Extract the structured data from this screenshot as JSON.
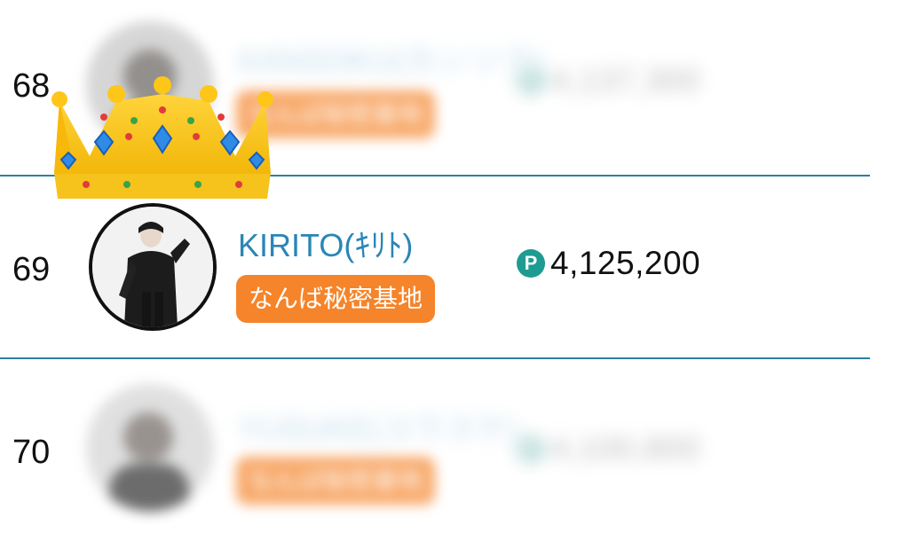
{
  "ranking": [
    {
      "rank": "68",
      "name": "KANSOKU(カンソク)",
      "store": "なんば秘密基地",
      "points": "4,137,300",
      "blurred": true
    },
    {
      "rank": "69",
      "name": "KIRITO(ｷﾘﾄ)",
      "store": "なんば秘密基地",
      "points": "4,125,200",
      "blurred": false
    },
    {
      "rank": "70",
      "name": "YUSUKE(ユウスケ)",
      "store": "なんば秘密基地",
      "points": "4,100,800",
      "blurred": true
    }
  ],
  "icons": {
    "points": "P",
    "crown": "crown-icon"
  },
  "colors": {
    "name": "#2a86b6",
    "badge": "#f5842a",
    "points_icon": "#1e9b92",
    "divider": "#2d7ea6"
  }
}
